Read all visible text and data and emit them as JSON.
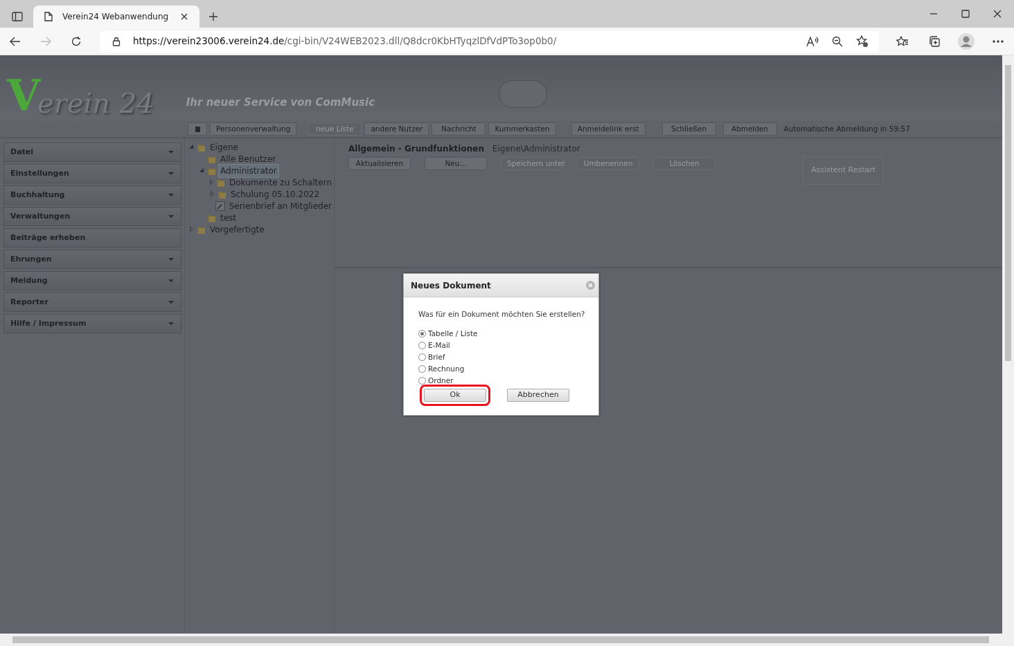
{
  "browser": {
    "tab_title": "Verein24 Webanwendung",
    "url_host": "https://verein23006.verein24.de",
    "url_path": "/cgi-bin/V24WEB2023.dll/Q8dcr0KbHTyqzlDfVdPTo3op0b0/"
  },
  "header": {
    "logo_initial": "V",
    "logo_rest": "erein 24",
    "tagline": "Ihr neuer Service von ComMusic"
  },
  "toolbar": {
    "buttons": [
      {
        "kind": "icon",
        "disabled": false
      },
      {
        "kind": "text",
        "label": "Personenverwaltung",
        "disabled": false
      },
      {
        "kind": "text",
        "label": "neue Liste",
        "disabled": true
      },
      {
        "kind": "text",
        "label": "andere Nutzer",
        "disabled": false
      },
      {
        "kind": "text",
        "label": "Nachricht",
        "disabled": false
      },
      {
        "kind": "text",
        "label": "Kummerkasten",
        "disabled": false
      },
      {
        "kind": "text",
        "label": "Anmeldelink erst",
        "disabled": false
      },
      {
        "kind": "text",
        "label": "Schließen",
        "disabled": false
      },
      {
        "kind": "text",
        "label": "Abmelden",
        "disabled": false
      }
    ],
    "auto_logout": "Automatische Abmeldung in 59:57"
  },
  "sidebar": {
    "items": [
      {
        "label": "Datei",
        "dropdown": true
      },
      {
        "label": "Einstellungen",
        "dropdown": true
      },
      {
        "label": "Buchhaltung",
        "dropdown": true
      },
      {
        "label": "Verwaltungen",
        "dropdown": true
      },
      {
        "label": "Beiträge erheben",
        "dropdown": false
      },
      {
        "label": "Ehrungen",
        "dropdown": true
      },
      {
        "label": "Meldung",
        "dropdown": true
      },
      {
        "label": "Reporter",
        "dropdown": true
      },
      {
        "label": "Hilfe / Impressum",
        "dropdown": true
      }
    ]
  },
  "tree": [
    {
      "label": "Eigene",
      "kind": "folder",
      "expanded": true,
      "selected": false,
      "children": [
        {
          "label": "Alle Benutzer",
          "kind": "folder",
          "selected": false
        },
        {
          "label": "Administrator",
          "kind": "folder",
          "expanded": true,
          "selected": true,
          "children": [
            {
              "label": "Dokumente zu Schaltern",
              "kind": "folder",
              "expanded": false,
              "selected": false
            },
            {
              "label": "Schulung 05.10.2022",
              "kind": "folder",
              "expanded": false,
              "selected": false
            },
            {
              "label": "Serienbrief an Mitglieder",
              "kind": "document",
              "selected": false
            }
          ]
        },
        {
          "label": "test",
          "kind": "folder",
          "selected": false
        }
      ]
    },
    {
      "label": "Vorgefertigte",
      "kind": "folder",
      "expanded": false,
      "selected": false
    }
  ],
  "panel": {
    "title": "Allgemein - Grundfunktionen",
    "path": "Eigene\\Administrator",
    "buttons": [
      {
        "label": "Aktualisieren",
        "disabled": false
      },
      {
        "label": "Neu...",
        "disabled": false
      },
      {
        "label": "Speichern unter",
        "disabled": true
      },
      {
        "label": "Umbenennen",
        "disabled": true
      },
      {
        "label": "Löschen",
        "disabled": true
      }
    ],
    "assistant_button": {
      "label": "Assistent Restart",
      "disabled": true
    }
  },
  "dialog": {
    "title": "Neues Dokument",
    "question": "Was für ein Dokument möchten Sie erstellen?",
    "options": [
      {
        "label": "Tabelle / Liste",
        "selected": true
      },
      {
        "label": "E-Mail",
        "selected": false
      },
      {
        "label": "Brief",
        "selected": false
      },
      {
        "label": "Rechnung",
        "selected": false
      },
      {
        "label": "Ordner",
        "selected": false
      }
    ],
    "buttons": [
      {
        "label": "Ok",
        "highlighted": true
      },
      {
        "label": "Abbrechen",
        "highlighted": false
      }
    ]
  }
}
